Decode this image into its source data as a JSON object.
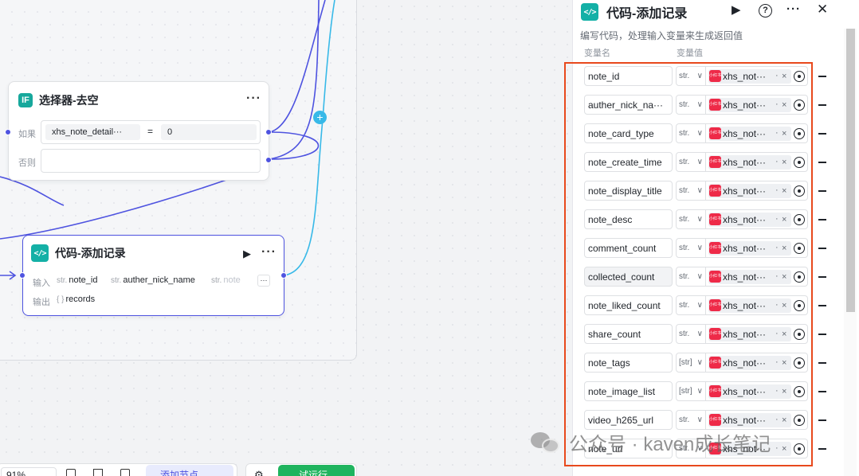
{
  "canvas": {
    "if_node": {
      "title": "选择器-去空",
      "icon_text": "IF",
      "if_label": "如果",
      "else_label": "否则",
      "left_operand": "xhs_note_detail···",
      "operator": "=",
      "right_operand": "0"
    },
    "code_node": {
      "title": "代码-添加记录",
      "input_label": "输入",
      "output_label": "输出",
      "inputs": [
        {
          "type": "str.",
          "name": "note_id"
        },
        {
          "type": "str.",
          "name": "auther_nick_name"
        },
        {
          "type": "str.",
          "name": "note"
        }
      ],
      "more_inputs": "···",
      "output": {
        "type": "{ }",
        "name": "records"
      }
    },
    "toolbar": {
      "zoom": "91%",
      "add_node_label": "添加节点",
      "run_label": "试运行"
    }
  },
  "panel": {
    "title": "代码-添加记录",
    "description": "编写代码，处理输入变量来生成返回值",
    "col_name_header": "变量名",
    "col_value_header": "变量值",
    "variables": [
      {
        "name": "note_id",
        "type": "str.",
        "value": "xhs_not···"
      },
      {
        "name": "auther_nick_na···",
        "type": "str.",
        "value": "xhs_not···"
      },
      {
        "name": "note_card_type",
        "type": "str.",
        "value": "xhs_not···"
      },
      {
        "name": "note_create_time",
        "type": "str.",
        "value": "xhs_not···"
      },
      {
        "name": "note_display_title",
        "type": "str.",
        "value": "xhs_not···"
      },
      {
        "name": "note_desc",
        "type": "str.",
        "value": "xhs_not···"
      },
      {
        "name": "comment_count",
        "type": "str.",
        "value": "xhs_not···"
      },
      {
        "name": "collected_count",
        "type": "str.",
        "value": "xhs_not···"
      },
      {
        "name": "note_liked_count",
        "type": "str.",
        "value": "xhs_not···"
      },
      {
        "name": "share_count",
        "type": "str.",
        "value": "xhs_not···"
      },
      {
        "name": "note_tags",
        "type": "[str]",
        "value": "xhs_not···"
      },
      {
        "name": "note_image_list",
        "type": "[str]",
        "value": "xhs_not···"
      },
      {
        "name": "video_h265_url",
        "type": "str.",
        "value": "xhs_not···"
      },
      {
        "name": "note_url",
        "type": "str.",
        "value": "xhs_not···"
      }
    ],
    "source_icon_text": "小红书",
    "colors": {
      "accent": "#4e53e0",
      "highlight": "#e8491d",
      "run": "#1fb45e"
    }
  },
  "watermark": {
    "text": "公众号 · kaven成长笔记"
  }
}
